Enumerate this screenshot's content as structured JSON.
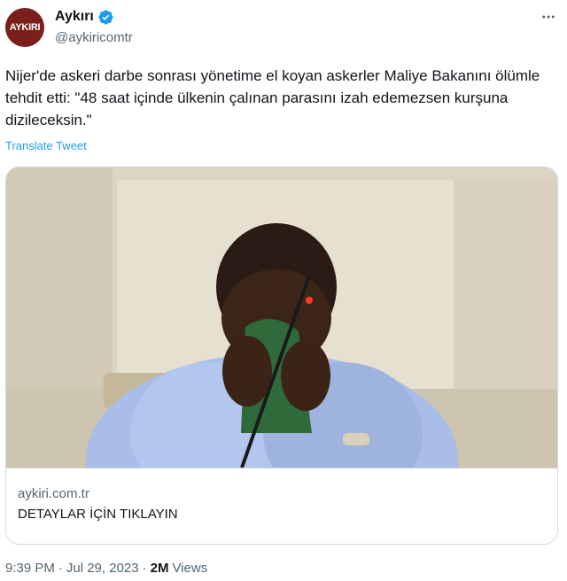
{
  "author": {
    "avatar_text": "AYKIRI",
    "display_name": "Aykırı",
    "handle": "@aykiricomtr",
    "verified_icon": "verified-badge-icon"
  },
  "more_icon": "more-options-icon",
  "tweet": {
    "text": "Nijer'de askeri darbe sonrası yönetime el koyan askerler Maliye Bakanını ölümle tehdit etti: \"48 saat içinde ülkenin çalınan parasını izah edemezsen kurşuna dizileceksin.\"",
    "translate_label": "Translate Tweet"
  },
  "card": {
    "domain": "aykiri.com.tr",
    "title": "DETAYLAR İÇİN TIKLAYIN"
  },
  "meta": {
    "time": "9:39 PM",
    "separator": "·",
    "date": "Jul 29, 2023",
    "views_count": "2M",
    "views_label": "Views"
  },
  "colors": {
    "accent": "#1d9bf0",
    "avatar_bg": "#7a1f1b",
    "text_primary": "#0f1419",
    "text_secondary": "#536471",
    "border": "#cfd9de"
  }
}
